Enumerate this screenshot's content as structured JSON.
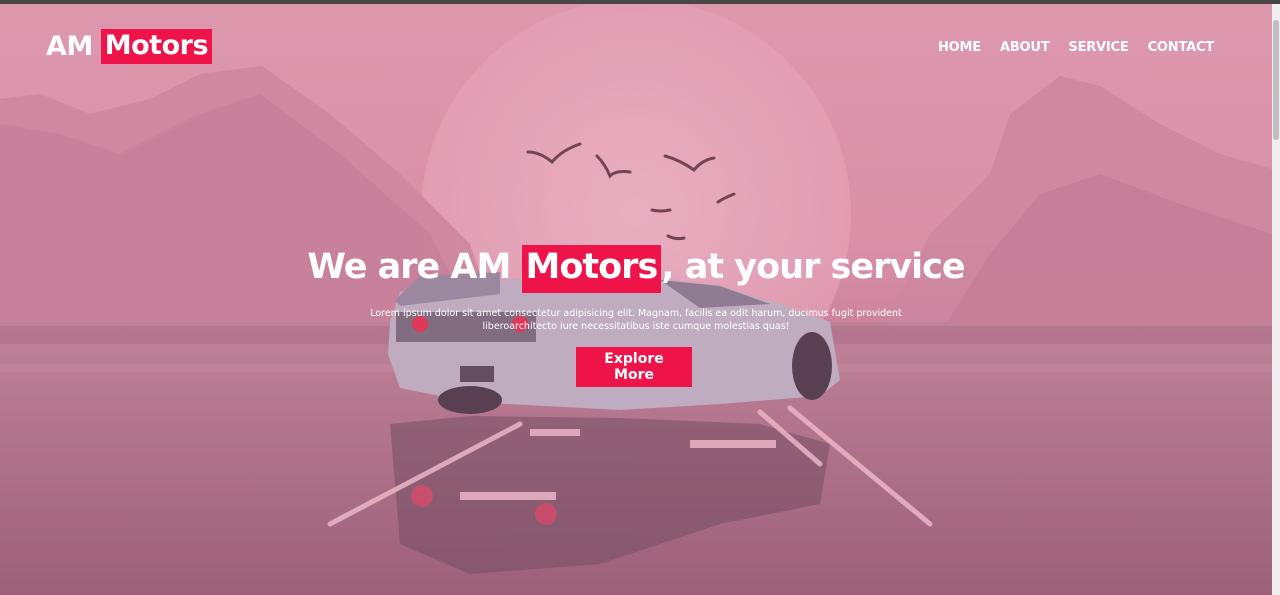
{
  "brand": {
    "prefix": "AM",
    "highlight": "Motors",
    "accent_color": "#ee1348"
  },
  "nav": {
    "items": [
      "HOME",
      "ABOUT",
      "SERVICE",
      "CONTACT"
    ]
  },
  "hero": {
    "heading_prefix": "We are AM ",
    "heading_highlight": "Motors",
    "heading_suffix": ", at your service",
    "description_line1": "Lorem ipsum dolor sit amet consectetur adipisicing elit. Magnam, facilis ea odit harum, ducimus fugit provident",
    "description_line2": "liberoarchitecto iure necessitatibus iste cumque molestias quas!",
    "cta_label": "Explore More",
    "background_image": "pink sunset sports car on reflective road"
  }
}
